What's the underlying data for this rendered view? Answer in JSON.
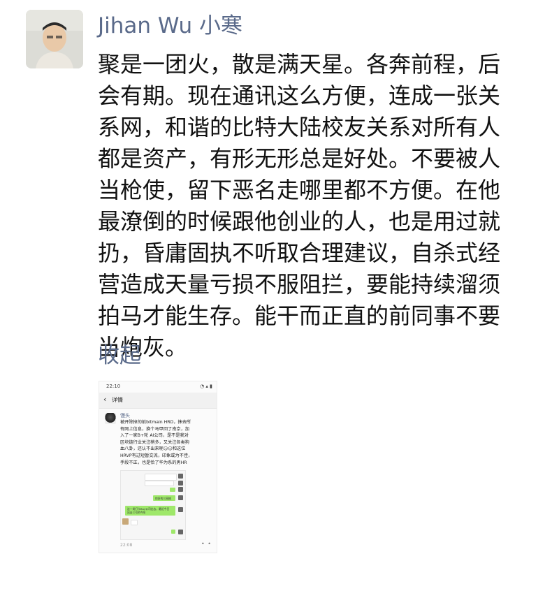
{
  "post": {
    "author": "Jihan Wu 小寒",
    "text": "聚是一团火，散是满天星。各奔前程，后\n会有期。现在通讯这么方便，连成一张关\n系网，和谐的比特大陆校友关系对所有人\n都是资产，有形无形总是好处。不要被人\n当枪使，留下恶名走哪里都不方便。在他\n最潦倒的时候跟他创业的人，也是用过就\n扔，昏庸固执不听取合理建议，自杀式经\n营造成天量亏损不服阻拦，要能持续溜须\n拍马才能生存。能干而正直的前同事不要\n当炮灰。",
    "collapse_label": "收起"
  },
  "attachment": {
    "status_time": "22:10",
    "status_icons": "◔ ▴ ▮",
    "back_icon": "chevron-left-icon",
    "title": "详情",
    "author": "馒头",
    "text": "被开除掉的前bitmain HRD，抹去所\n有网上信息，换个马甲回了南京，加\n入了一家B+轮 AI公司，是不是我对\n区块链行业关注稍多，又关注各类狗\n血八卦，还认不出来呢😏😏和这位\nHRVP有过短暂交流，印象或为不佳，\n手段不正，也是恰了华为系的男HR",
    "bubble_a": "你好的三网格",
    "bubble_b": "这一类打卡Bay公司出去，最近今日\n出去三号的今年",
    "footer_time": "22:08",
    "footer_more": "• •"
  },
  "colors": {
    "author_link": "#5a6a8a",
    "body_text": "#111111",
    "bubble_green": "#9fe86a"
  }
}
